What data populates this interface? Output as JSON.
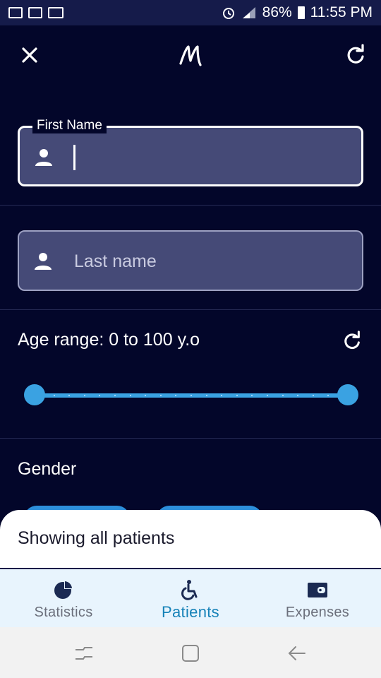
{
  "status_bar": {
    "battery": "86%",
    "time": "11:55 PM"
  },
  "form": {
    "first_name": {
      "label": "First Name",
      "value": ""
    },
    "last_name": {
      "placeholder": "Last name",
      "value": ""
    },
    "age_range": {
      "label": "Age range: 0 to 100 y.o",
      "min": 0,
      "max": 100,
      "selected_min": 0,
      "selected_max": 100
    },
    "gender": {
      "label": "Gender"
    }
  },
  "sheet": {
    "title": "Showing all patients"
  },
  "nav": {
    "items": [
      {
        "label": "Statistics",
        "icon": "pie-chart-icon",
        "active": false
      },
      {
        "label": "Patients",
        "icon": "wheelchair-icon",
        "active": true
      },
      {
        "label": "Expenses",
        "icon": "wallet-icon",
        "active": false
      }
    ]
  },
  "colors": {
    "background": "#03062a",
    "field_fill": "#454a77",
    "accent": "#3aa2e2",
    "nav_active": "#1682b8"
  }
}
